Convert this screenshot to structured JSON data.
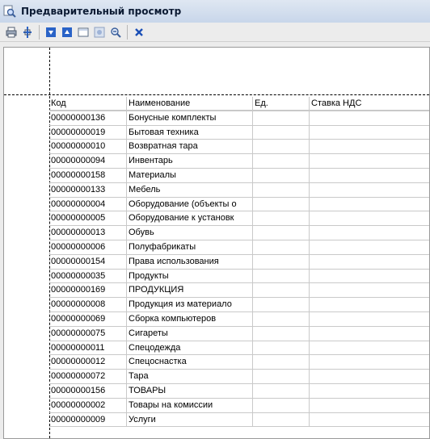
{
  "window": {
    "title": "Предварительный просмотр"
  },
  "toolbar": {
    "icons": [
      "print-icon",
      "fit-page-icon",
      "next-page-icon",
      "prev-page-icon",
      "page-view-icon",
      "zoom-in-icon",
      "zoom-out-icon",
      "close-icon"
    ]
  },
  "table": {
    "headers": [
      "Код",
      "Наименование",
      "Ед.",
      "Ставка НДС"
    ],
    "rows": [
      [
        "00000000136",
        "Бонусные комплекты",
        "",
        ""
      ],
      [
        "00000000019",
        "Бытовая техника",
        "",
        ""
      ],
      [
        "00000000010",
        "Возвратная тара",
        "",
        ""
      ],
      [
        "00000000094",
        "Инвентарь",
        "",
        ""
      ],
      [
        "00000000158",
        "Материалы",
        "",
        ""
      ],
      [
        "00000000133",
        "Мебель",
        "",
        ""
      ],
      [
        "00000000004",
        "Оборудование (объекты о",
        "",
        ""
      ],
      [
        "00000000005",
        "Оборудование к установк",
        "",
        ""
      ],
      [
        "00000000013",
        "Обувь",
        "",
        ""
      ],
      [
        "00000000006",
        "Полуфабрикаты",
        "",
        ""
      ],
      [
        "00000000154",
        "Права использования",
        "",
        ""
      ],
      [
        "00000000035",
        "Продукты",
        "",
        ""
      ],
      [
        "00000000169",
        "ПРОДУКЦИЯ",
        "",
        ""
      ],
      [
        "00000000008",
        "Продукция из материало",
        "",
        ""
      ],
      [
        "00000000069",
        "Сборка компьютеров",
        "",
        ""
      ],
      [
        "00000000075",
        "Сигареты",
        "",
        ""
      ],
      [
        "00000000011",
        "Спецодежда",
        "",
        ""
      ],
      [
        "00000000012",
        "Спецоснастка",
        "",
        ""
      ],
      [
        "00000000072",
        "Тара",
        "",
        ""
      ],
      [
        "00000000156",
        "ТОВАРЫ",
        "",
        ""
      ],
      [
        "00000000002",
        "Товары на комиссии",
        "",
        ""
      ],
      [
        "00000000009",
        "Услуги",
        "",
        ""
      ]
    ]
  },
  "colors": {
    "titlebar": "#c8d6ea",
    "accent_blue": "#2a63c7",
    "close_x": "#1b4fb6"
  }
}
